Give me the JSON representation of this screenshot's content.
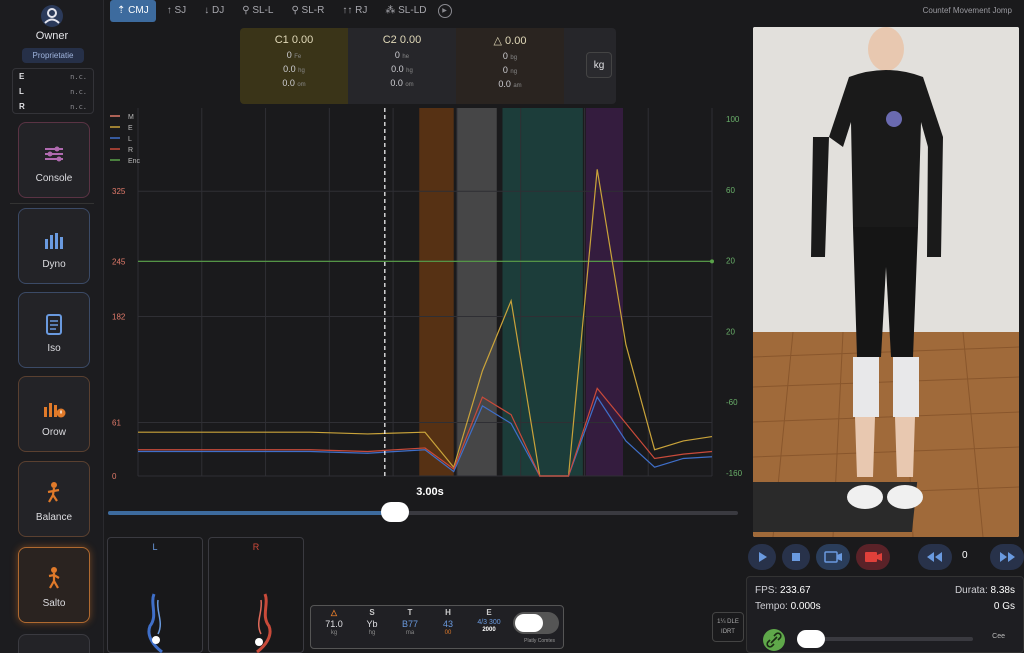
{
  "owner": {
    "name": "Owner",
    "badge": "Proprietatie"
  },
  "lr_status": [
    {
      "key": "E",
      "value": "n.c."
    },
    {
      "key": "L",
      "value": "n.c."
    },
    {
      "key": "R",
      "value": "n.c."
    }
  ],
  "nav": [
    {
      "label": "Console",
      "icon": "sliders-icon"
    },
    {
      "label": "Dyno",
      "icon": "bar-chart-icon"
    },
    {
      "label": "Iso",
      "icon": "clipboard-icon"
    },
    {
      "label": "Orow",
      "icon": "bars-alert-icon"
    },
    {
      "label": "Balance",
      "icon": "person-balance-icon"
    },
    {
      "label": "Salto",
      "icon": "person-jump-icon"
    }
  ],
  "tabs": [
    "CMJ",
    "SJ",
    "DJ",
    "SL-L",
    "SL-R",
    "RJ",
    "SL-LD"
  ],
  "active_tab": "CMJ",
  "app_title": "Countef Movement Jomp",
  "metrics": {
    "c1": {
      "header": "C1 0.00",
      "r1": "0",
      "r1u": "Fe",
      "r2": "0.0",
      "r2u": "hg",
      "r3": "0.0",
      "r3u": "om"
    },
    "c2": {
      "header": "C2 0.00",
      "r1": "0",
      "r1u": "he",
      "r2": "0.0",
      "r2u": "hg",
      "r3": "0.0",
      "r3u": "om"
    },
    "c3": {
      "header": "△ 0.00",
      "r1": "0",
      "r1u": "bg",
      "r2": "0",
      "r2u": "ng",
      "r3": "0.0",
      "r3u": "am"
    }
  },
  "unit_button": "kg",
  "chart_data": {
    "type": "line",
    "legend": [
      "M",
      "E",
      "L",
      "R",
      "Enc"
    ],
    "y_left_ticks": [
      0,
      61,
      182,
      245,
      325
    ],
    "y_right_ticks": [
      100,
      60,
      20,
      20,
      -60,
      -160
    ],
    "ylim": [
      0,
      420
    ],
    "x": [
      0.0,
      0.1,
      0.2,
      0.3,
      0.4,
      0.5,
      0.55,
      0.6,
      0.65,
      0.7,
      0.75,
      0.8,
      0.85,
      0.9,
      0.95,
      1.0
    ],
    "series": [
      {
        "name": "E",
        "color": "#c9a33a",
        "values": [
          50,
          50,
          50,
          50,
          48,
          50,
          10,
          120,
          200,
          0,
          0,
          350,
          150,
          30,
          40,
          45
        ]
      },
      {
        "name": "L",
        "color": "#3f6fc9",
        "values": [
          28,
          28,
          28,
          28,
          26,
          30,
          5,
          80,
          60,
          0,
          0,
          90,
          40,
          10,
          20,
          22
        ]
      },
      {
        "name": "R",
        "color": "#c94a3a",
        "values": [
          30,
          30,
          30,
          30,
          28,
          32,
          8,
          90,
          70,
          0,
          0,
          100,
          60,
          20,
          25,
          28
        ]
      }
    ],
    "horizontal_line": {
      "name": "Enc",
      "color": "#5aa34a",
      "y": 245
    },
    "regions": [
      {
        "name": "countermovement",
        "x": [
          0.49,
          0.55
        ],
        "color": "#6b3a12"
      },
      {
        "name": "flight",
        "x": [
          0.555,
          0.625
        ],
        "color": "#555555"
      },
      {
        "name": "landing",
        "x": [
          0.635,
          0.775
        ],
        "color": "#1e4a44"
      },
      {
        "name": "stabilize",
        "x": [
          0.78,
          0.845
        ],
        "color": "#3e1e4a"
      }
    ],
    "cursor_x": 0.43
  },
  "playback": {
    "time": "3.00s",
    "progress": 0.455
  },
  "feet": {
    "left_label": "L",
    "right_label": "R"
  },
  "stats": [
    {
      "a": "△",
      "b": "71.0",
      "c": "kg"
    },
    {
      "a": "S",
      "b": "Yb",
      "c": "hg"
    },
    {
      "a": "T",
      "b": "B77",
      "c": "ma"
    },
    {
      "a": "H",
      "b": "43",
      "c": "00"
    },
    {
      "a": "E",
      "b": "4/3 300",
      "c": "2000"
    }
  ],
  "toggle_label": "Platly Comtes",
  "mini_tag": "1¼ DLE\nIDRT",
  "video": {
    "frame": "0",
    "fps_label": "FPS:",
    "fps_value": "233.67",
    "durata_label": "Durata:",
    "durata_value": "8.38s",
    "tempo_label": "Tempo:",
    "tempo_value": "0.000s",
    "gs_value": "0 Gs",
    "end_label": "Cee"
  },
  "colors": {
    "accent": "#3d6b9e",
    "brand": "#5b4fa8",
    "salto": "#e07a2a"
  }
}
